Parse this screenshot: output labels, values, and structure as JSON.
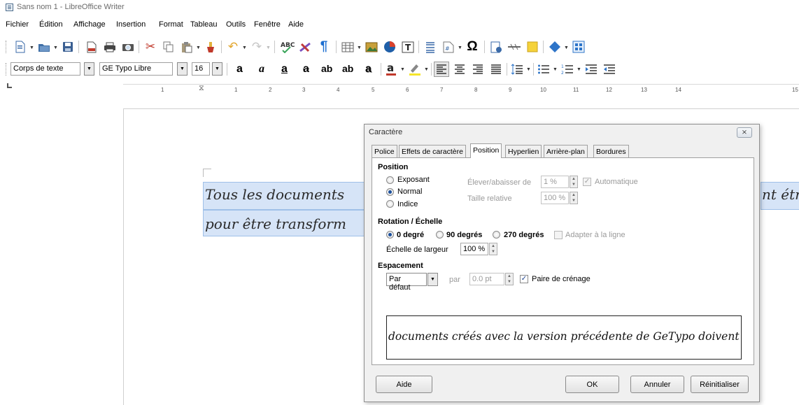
{
  "window": {
    "title": "Sans nom 1 - LibreOffice Writer"
  },
  "menu": [
    {
      "label": "Fichier"
    },
    {
      "label": "Édition"
    },
    {
      "label": "Affichage"
    },
    {
      "label": "Insertion"
    },
    {
      "label": "Format"
    },
    {
      "label": "Tableau"
    },
    {
      "label": "Outils"
    },
    {
      "label": "Fenêtre"
    },
    {
      "label": "Aide"
    }
  ],
  "toolbar1": {
    "icons": [
      "new-document",
      "open",
      "save",
      "export-pdf",
      "print",
      "print-preview",
      "cut",
      "copy",
      "paste",
      "clone-formatting",
      "undo",
      "redo",
      "spellcheck",
      "autospellcheck",
      "formatting-marks",
      "insert-table",
      "insert-image",
      "insert-chart",
      "insert-textbox",
      "insert-page-break",
      "insert-field",
      "special-character",
      "insert-hyperlink",
      "insert-footnote",
      "insert-comment",
      "track-changes",
      "basic-shapes",
      "insert-frame"
    ]
  },
  "toolbar2": {
    "paragraph_style": "Corps de texte",
    "font_name": "GE Typo Libre",
    "font_size": "16",
    "format_buttons": [
      "a",
      "a",
      "a",
      "a",
      "ab",
      "ab",
      "a"
    ]
  },
  "ruler": {
    "numbers": [
      "1",
      "1",
      "2",
      "3",
      "4",
      "5",
      "6",
      "7",
      "8",
      "9",
      "10",
      "11",
      "12",
      "13",
      "14",
      "15"
    ]
  },
  "document": {
    "line1_left": "Tous les documents",
    "line1_right": "nt étr",
    "line2_left": "pour être transform"
  },
  "dialog": {
    "title": "Caractère",
    "close_glyph": "⨯",
    "tabs": [
      {
        "label": "Police"
      },
      {
        "label": "Effets de caractère"
      },
      {
        "label": "Position",
        "active": true
      },
      {
        "label": "Hyperlien"
      },
      {
        "label": "Arrière-plan"
      },
      {
        "label": "Bordures"
      }
    ],
    "position": {
      "heading": "Position",
      "options": [
        {
          "label": "Exposant",
          "checked": false
        },
        {
          "label": "Normal",
          "checked": true
        },
        {
          "label": "Indice",
          "checked": false
        }
      ],
      "raise_label": "Élever/abaisser de",
      "raise_value": "1 %",
      "auto_label": "Automatique",
      "auto_checked": true,
      "relative_label": "Taille relative",
      "relative_value": "100 %"
    },
    "rotation": {
      "heading": "Rotation / Échelle",
      "options": [
        {
          "label": "0 degré",
          "checked": true
        },
        {
          "label": "90 degrés",
          "checked": false
        },
        {
          "label": "270 degrés",
          "checked": false
        }
      ],
      "fit_label": "Adapter à la ligne",
      "fit_checked": false,
      "scale_label": "Échelle de largeur",
      "scale_value": "100 %"
    },
    "spacing": {
      "heading": "Espacement",
      "mode": "Par défaut",
      "by_label": "par",
      "by_value": "0.0 pt",
      "kerning_label": "Paire de crénage",
      "kerning_checked": true
    },
    "preview_text": "documents créés avec la version précédente de GeTypo doivent",
    "buttons": {
      "help": "Aide",
      "ok": "OK",
      "cancel": "Annuler",
      "reset": "Réinitialiser"
    }
  },
  "colors": {
    "selection": "#d6e4f7",
    "radio_dot": "#1a4f9c",
    "text_disabled": "#9a9a9a"
  }
}
